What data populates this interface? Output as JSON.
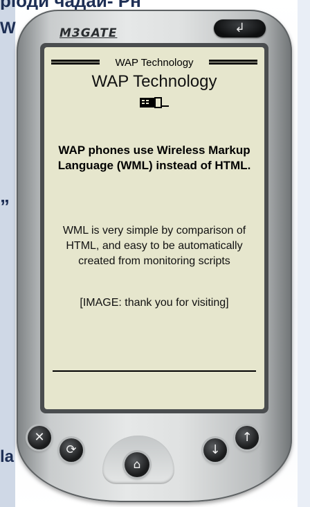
{
  "background": {
    "top_fragment": "ріоди чадаи- Рн",
    "w_fragment": "W",
    "quote_fragment": "”",
    "la_fragment": "la"
  },
  "device": {
    "brand": "M3GATE",
    "back_icon": "back-arrow-icon",
    "buttons": {
      "close": {
        "icon": "close-icon",
        "glyph": "✕"
      },
      "refresh": {
        "icon": "refresh-icon",
        "glyph": "⟳"
      },
      "home": {
        "icon": "home-icon",
        "glyph": "⌂"
      },
      "down": {
        "icon": "arrow-down-icon",
        "glyph": "↓"
      },
      "up": {
        "icon": "arrow-up-icon",
        "glyph": "↑"
      }
    },
    "back_glyph": "↲"
  },
  "screen": {
    "header": "WAP Technology",
    "title": "WAP Technology",
    "intro_bold": "WAP phones use Wireless Markup Language (WML) instead of HTML.",
    "paragraph": "WML is very simple by comparison of HTML, and easy to be automatically created from monitoring scripts",
    "image_alt": "[IMAGE: thank you for visiting]"
  },
  "colors": {
    "screen_bg": "#e6e6cd",
    "device_body": "#dfe1e1",
    "button": "#1a1b1c"
  }
}
